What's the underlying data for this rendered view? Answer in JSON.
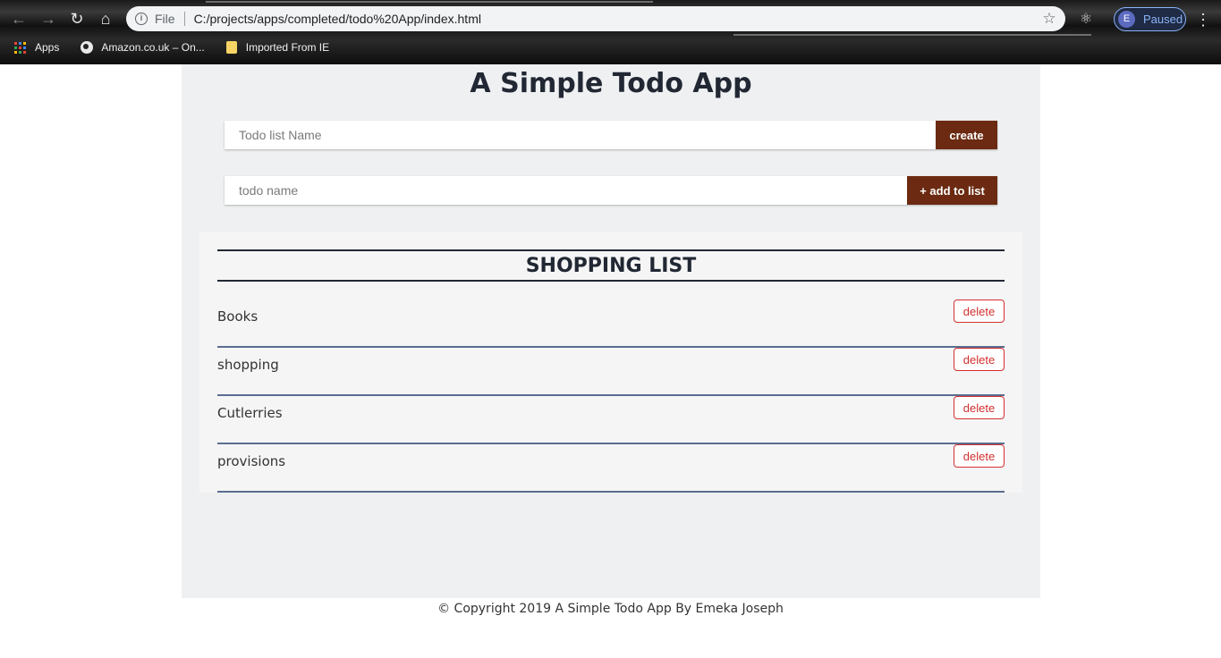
{
  "browser": {
    "scheme_label": "File",
    "url": "C:/projects/apps/completed/todo%20App/index.html",
    "profile_initial": "E",
    "profile_status": "Paused",
    "bookmarks": [
      {
        "label": "Apps",
        "icon": "apps-grid-icon"
      },
      {
        "label": "Amazon.co.uk – On...",
        "icon": "globe-icon"
      },
      {
        "label": "Imported From IE",
        "icon": "folder-icon"
      }
    ]
  },
  "app": {
    "title": "A Simple Todo App",
    "list_name_placeholder": "Todo list Name",
    "create_label": "create",
    "todo_name_placeholder": "todo name",
    "add_label": "+ add to list"
  },
  "list": {
    "title": "SHOPPING LIST",
    "delete_label": "delete",
    "items": [
      {
        "name": "Books"
      },
      {
        "name": "shopping"
      },
      {
        "name": "Cutlerries"
      },
      {
        "name": "provisions"
      }
    ]
  },
  "footer": {
    "text": "© Copyright 2019 A Simple Todo App By Emeka Joseph"
  },
  "colors": {
    "button_dark": "#6b2a11",
    "delete_red": "#d32f2f",
    "divider_blue": "#5a6d90",
    "page_bg": "#eff0f2"
  }
}
